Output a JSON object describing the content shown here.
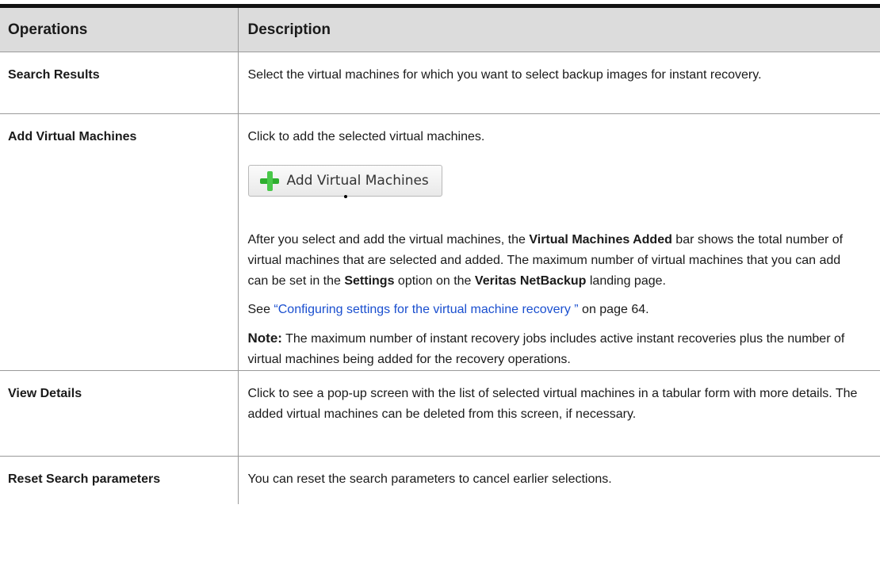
{
  "table": {
    "header": {
      "operations": "Operations",
      "description": "Description"
    },
    "rows": [
      {
        "op": "Search Results",
        "desc": "Select the virtual machines for which you want to select backup images for instant recovery."
      },
      {
        "op": "Add Virtual Machines",
        "desc": "Click to add the selected virtual machines.",
        "button_label": "Add Virtual Machines",
        "para2": {
          "t1": "After you select and add the virtual machines, the ",
          "b1": "Virtual Machines Added",
          "t2": " bar shows the total number of virtual machines that are selected and added. The maximum number of virtual machines that you can add can be set in the ",
          "b2": "Settings",
          "t3": " option on the ",
          "b3": "Veritas NetBackup",
          "t4": " landing page."
        },
        "see": {
          "prefix": "See ",
          "link": "“Configuring settings for the virtual machine recovery ”",
          "suffix": " on page 64."
        },
        "note": {
          "label": "Note:",
          "text": " The maximum number of instant recovery jobs includes active instant recoveries plus the number of virtual machines being added for the recovery operations."
        }
      },
      {
        "op": "View Details",
        "desc": "Click to see a pop-up screen with the list of selected virtual machines in a tabular form with more details. The added virtual machines can be deleted from this screen, if necessary."
      },
      {
        "op": "Reset Search parameters",
        "desc": "You can reset the search parameters to cancel earlier selections."
      }
    ]
  }
}
